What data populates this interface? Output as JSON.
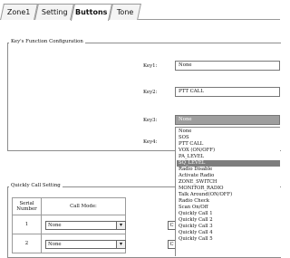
{
  "tabs": [
    {
      "label": "Zone1"
    },
    {
      "label": "Setting"
    },
    {
      "label": "Buttons"
    },
    {
      "label": "Tone"
    }
  ],
  "key_config": {
    "legend": "Key's Function Configuration",
    "rows": [
      {
        "label": "Key1:",
        "value": "None"
      },
      {
        "label": "Key2:",
        "value": "PTT CALL"
      },
      {
        "label": "Key3:",
        "value": "None"
      },
      {
        "label": "Key4:",
        "value": ""
      }
    ]
  },
  "dropdown": {
    "options": [
      "None",
      "SOS",
      "PTT CALL",
      "VOX (ON/OFF)",
      "PA_LEVEL",
      "SQ_LEVEL",
      "Radio Disable",
      "Activate Radio",
      "ZONE_SWITCH",
      "MONITOR_RADIO",
      "Talk Around(ON/OFF)",
      "Radio Check",
      "Scan On/Off",
      "Quickly Call 1",
      "Quickly Call 2",
      "Quickly Call 3",
      "Quickly Call 4",
      "Quickly Call 5"
    ],
    "highlighted_index": 5
  },
  "quick_call": {
    "legend": "Quickly Call Setting",
    "headers": [
      "Serial Number",
      "Call Mode:"
    ],
    "rows": [
      {
        "serial": "1",
        "mode": "None",
        "stub": "C"
      },
      {
        "serial": "2",
        "mode": "None",
        "stub": "C"
      }
    ]
  }
}
